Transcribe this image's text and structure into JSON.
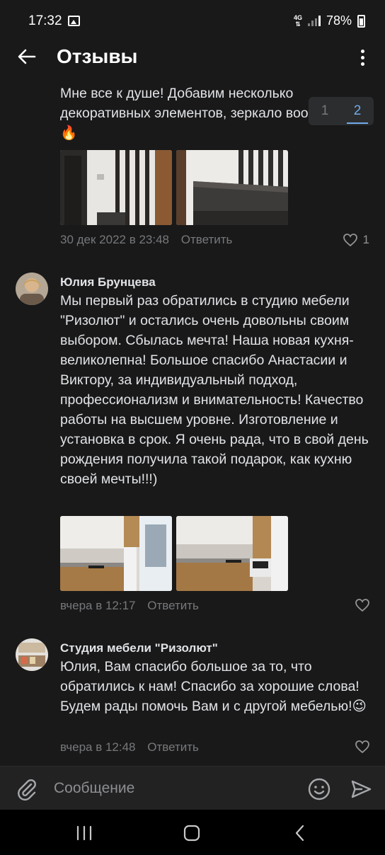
{
  "status": {
    "time": "17:32",
    "network": "4G",
    "battery": "78%"
  },
  "header": {
    "title": "Отзывы"
  },
  "pager": {
    "pages": [
      "1",
      "2"
    ],
    "active": "2"
  },
  "comments": [
    {
      "text": "Мне все к душе! Добавим несколько декоративных элементов, зеркало вообще огонь",
      "emoji": "🔥",
      "date": "30 дек 2022 в 23:48",
      "reply": "Ответить",
      "likes": "1"
    },
    {
      "author": "Юлия Брунцева",
      "text": "Мы первый раз обратились в студию мебели \"Ризолют\"  и остались очень довольны своим выбором. Сбылась мечта! Наша новая кухня- великолепна! Большое спасибо Анастасии и Виктору, за индивидуальный подход, профессионализм и внимательность! Качество работы на высшем уровне. Изготовление и установка в срок. Я очень рада, что в свой день рождения получила такой подарок, как кухню своей мечты!!!)",
      "date": "вчера в 12:17",
      "reply": "Ответить"
    },
    {
      "author": "Студия мебели \"Ризолют\"",
      "text": "Юлия, Вам спасибо большое за то, что обратились к нам! Спасибо за хорошие слова! Будем рады помочь Вам и с другой мебелью!",
      "emoji": "😉",
      "date": "вчера в 12:48",
      "reply": "Ответить"
    }
  ],
  "composer": {
    "placeholder": "Сообщение"
  },
  "colors": {
    "background": "#19191a",
    "accent": "#71aaeb",
    "muted": "#76787a"
  }
}
